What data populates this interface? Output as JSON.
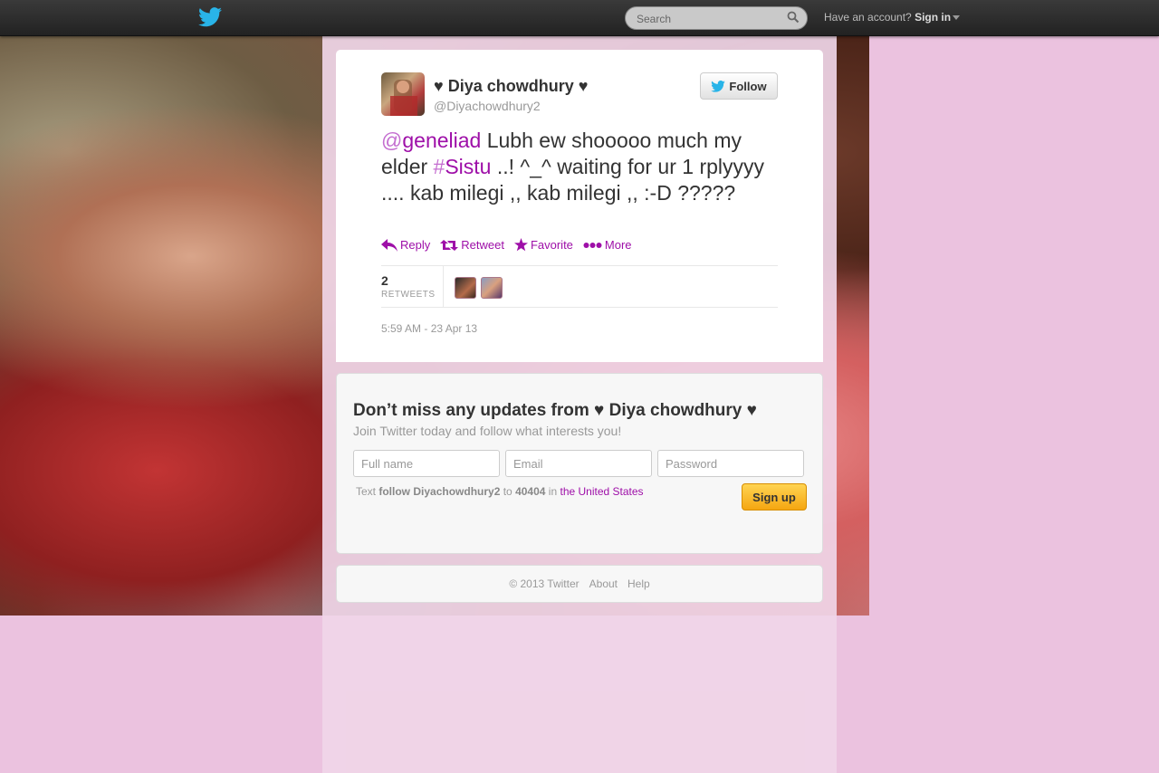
{
  "topbar": {
    "logo": "twitter-bird-icon",
    "search_placeholder": "Search",
    "have_account": "Have an account?",
    "sign_in": "Sign in"
  },
  "tweet": {
    "display_name": "♥ Diya chowdhury ♥",
    "screen_name": "@Diyachowdhury2",
    "follow_label": "Follow",
    "mention_sym": "@",
    "mention": "geneliad",
    "text_part1": " Lubh ew shooooo much my elder ",
    "hashtag_sym": "#",
    "hashtag": "Sistu",
    "text_part2": " ..! ^_^ waiting for ur 1 rplyyyy .... kab milegi ,, kab milegi ,, :-D ?????",
    "actions": {
      "reply": "Reply",
      "retweet": "Retweet",
      "favorite": "Favorite",
      "more": "More"
    },
    "retweet_count": "2",
    "retweets_label": "RETWEETS",
    "timestamp": "5:59 AM - 23 Apr 13"
  },
  "signup": {
    "title": "Don’t miss any updates from ♥ Diya chowdhury ♥",
    "subtitle": "Join Twitter today and follow what interests you!",
    "name_placeholder": "Full name",
    "email_placeholder": "Email",
    "password_placeholder": "Password",
    "sms_text": "Text",
    "sms_command": "follow Diyachowdhury2",
    "sms_to": "to",
    "sms_number": "40404",
    "sms_in": "in",
    "sms_country": "the United States",
    "button": "Sign up"
  },
  "footer": {
    "copyright": "© 2013 Twitter",
    "about": "About",
    "help": "Help"
  },
  "colors": {
    "link": "#9e0fa8",
    "background": "#ebc2df",
    "signup_button": "#f5a611"
  }
}
